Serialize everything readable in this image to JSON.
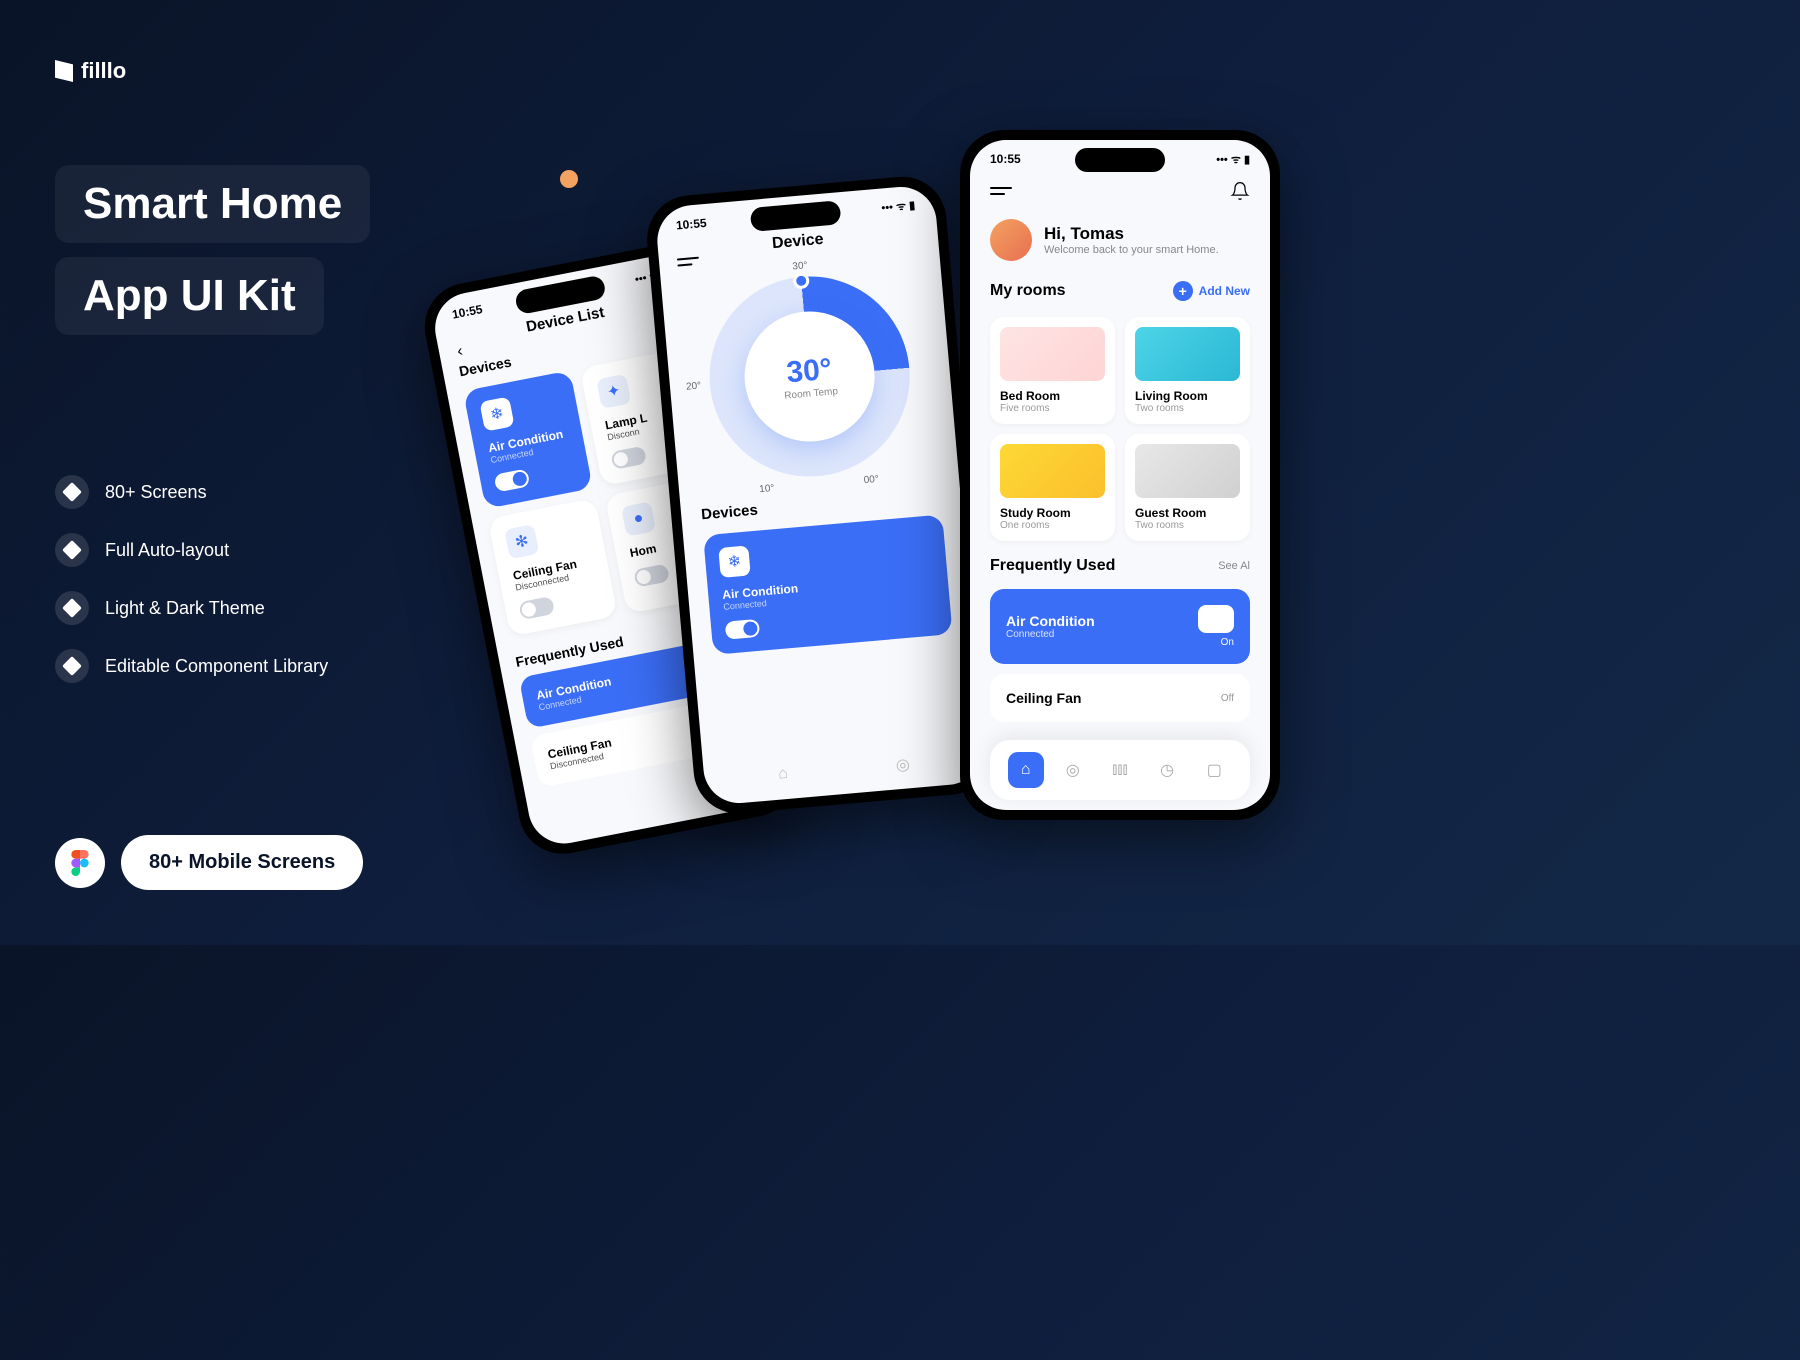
{
  "brand": "filllo",
  "headline": {
    "line1": "Smart Home",
    "line2": "App UI Kit"
  },
  "features": [
    "80+ Screens",
    "Full Auto-layout",
    "Light & Dark Theme",
    "Editable Component Library"
  ],
  "cta": "80+ Mobile Screens",
  "statusTime": "10:55",
  "phone1": {
    "title": "Device List",
    "section": "Devices",
    "devices": [
      {
        "name": "Air Condition",
        "status": "Connected",
        "on": true
      },
      {
        "name": "Lamp L",
        "status": "Disconn",
        "on": false
      },
      {
        "name": "Ceiling Fan",
        "status": "Disconnected",
        "on": false
      },
      {
        "name": "Hom",
        "status": "",
        "on": false
      }
    ],
    "freqTitle": "Frequently Used",
    "freq": [
      {
        "name": "Air Condition",
        "status": "Connected"
      },
      {
        "name": "Ceiling Fan",
        "status": "Disconnected"
      }
    ]
  },
  "phone2": {
    "title": "Device",
    "temp": "30°",
    "tempLabel": "Room Temp",
    "ticks": {
      "top": "30°",
      "left": "20°",
      "bl": "10°",
      "br": "00°"
    },
    "section": "Devices",
    "device": {
      "name": "Air Condition",
      "status": "Connected"
    }
  },
  "phone3": {
    "greeting": "Hi, Tomas",
    "subGreeting": "Welcome back to your smart Home.",
    "roomsTitle": "My rooms",
    "addNew": "Add New",
    "rooms": [
      {
        "name": "Bed Room",
        "sub": "Five rooms"
      },
      {
        "name": "Living Room",
        "sub": "Two rooms"
      },
      {
        "name": "Study Room",
        "sub": "One rooms"
      },
      {
        "name": "Guest Room",
        "sub": "Two rooms"
      }
    ],
    "freqTitle": "Frequently Used",
    "seeAll": "See Al",
    "freq": [
      {
        "name": "Air Condition",
        "status": "Connected",
        "state": "On",
        "blue": true
      },
      {
        "name": "Ceiling Fan",
        "status": "",
        "state": "Off",
        "blue": false
      }
    ]
  }
}
